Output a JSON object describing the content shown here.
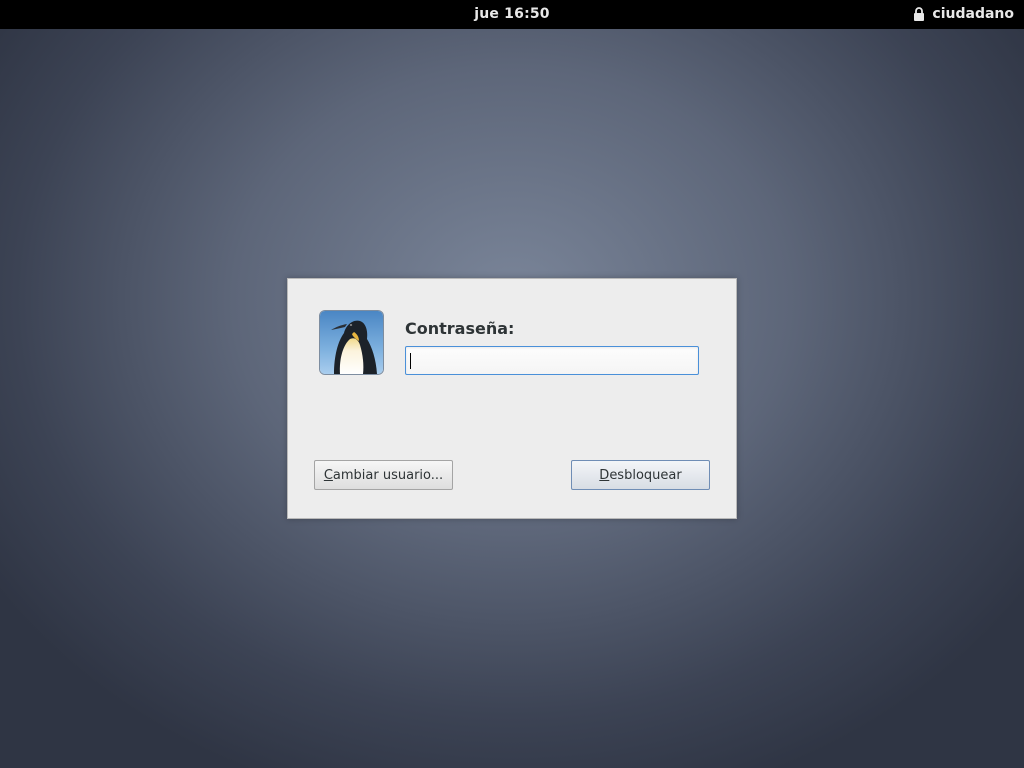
{
  "topbar": {
    "clock": "jue 16:50",
    "user": "ciudadano",
    "lock_icon": "lock-icon"
  },
  "dialog": {
    "avatar_icon": "penguin-avatar",
    "prompt_label": "Contraseña:",
    "password_value": "",
    "switch_user_button": {
      "mnemonic": "C",
      "rest": "ambiar usuario..."
    },
    "unlock_button": {
      "mnemonic": "D",
      "rest": "esbloquear"
    }
  },
  "colors": {
    "accent_focus": "#4a90d9",
    "topbar_bg": "#000000",
    "dialog_bg": "#ededed"
  }
}
